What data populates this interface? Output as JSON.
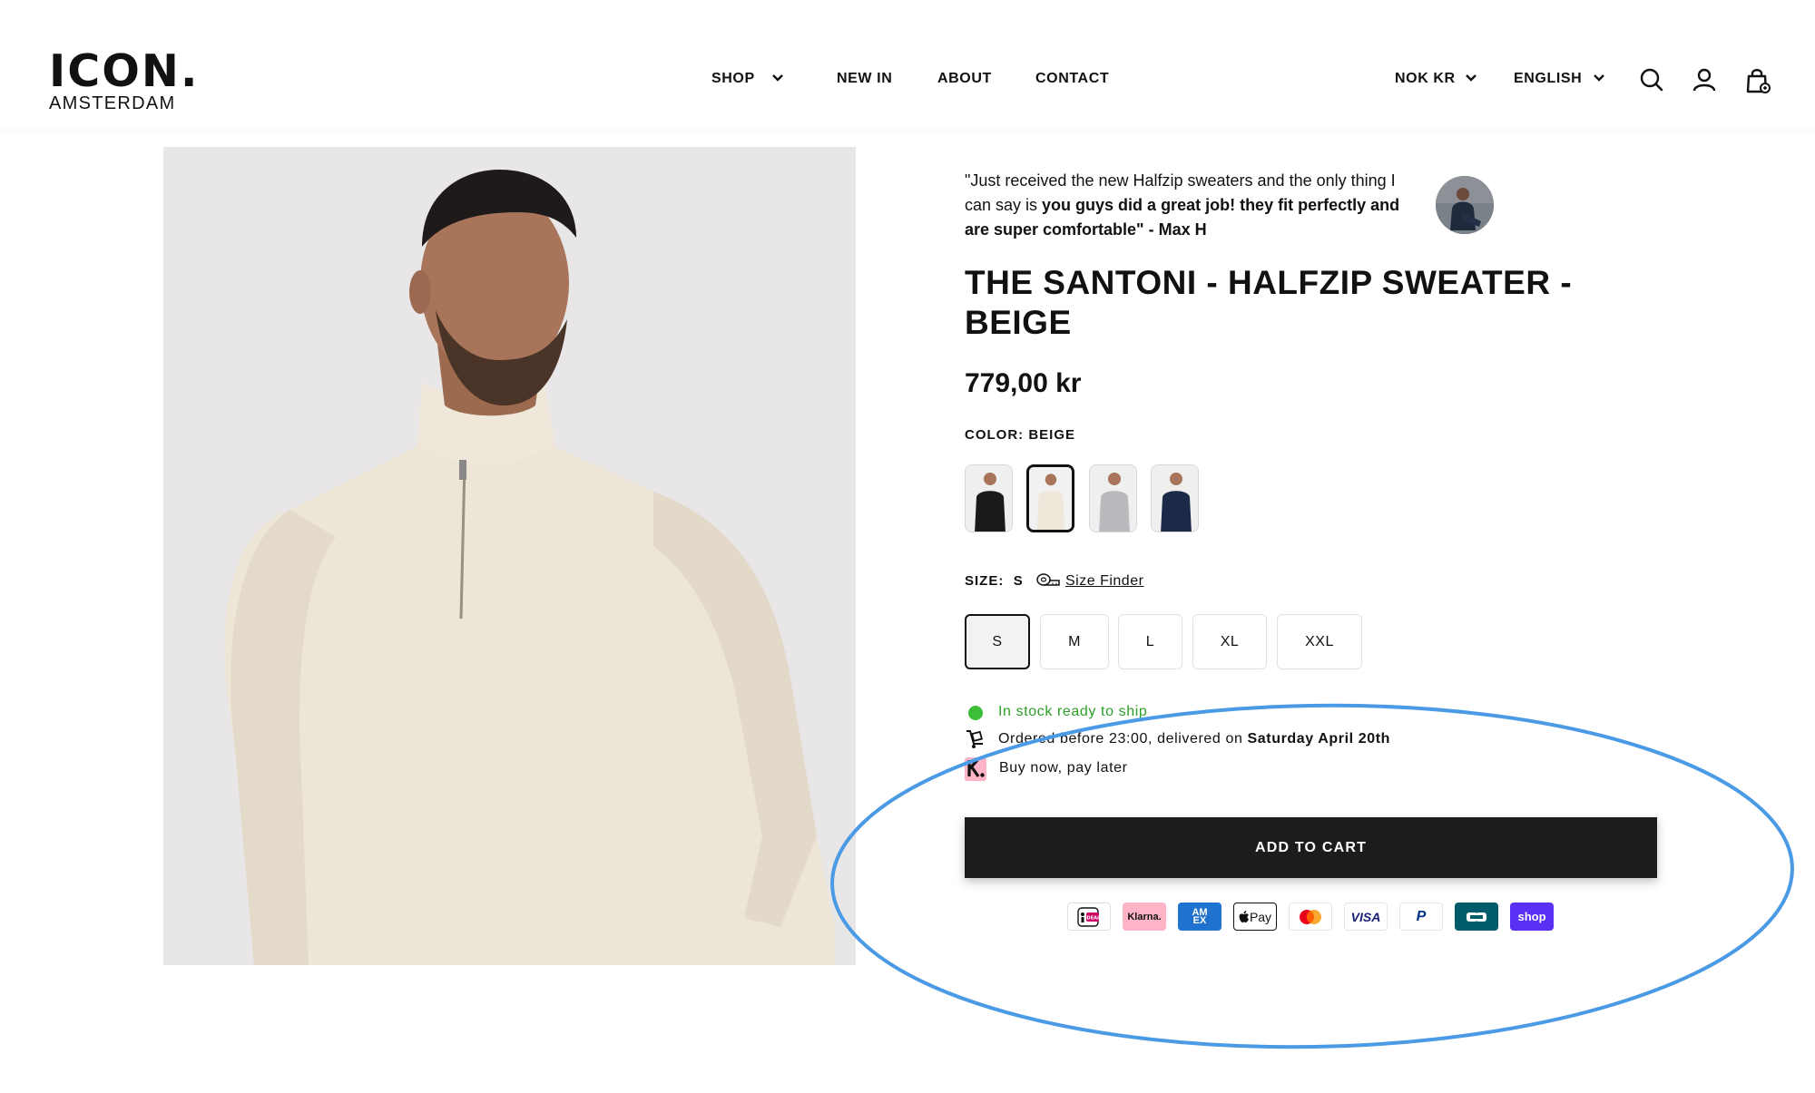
{
  "header": {
    "logo": {
      "main": "ICON.",
      "sub": "AMSTERDAM"
    },
    "nav": [
      {
        "label": "SHOP",
        "has_dropdown": true
      },
      {
        "label": "NEW IN",
        "has_dropdown": false
      },
      {
        "label": "ABOUT",
        "has_dropdown": false
      },
      {
        "label": "CONTACT",
        "has_dropdown": false
      }
    ],
    "currency": "NOK KR",
    "language": "ENGLISH",
    "icons": [
      "search-icon",
      "account-icon",
      "cart-icon"
    ]
  },
  "product": {
    "testimonial": {
      "text_plain": "\"Just received the new Halfzip sweaters and the only thing I can say is ",
      "text_bold": "you guys did a great job! they fit perfectly and are super comfortable\" - Max H"
    },
    "title": "THE SANTONI - HALFZIP SWEATER - BEIGE",
    "price": "779,00 kr",
    "color": {
      "label": "COLOR:",
      "value": "BEIGE",
      "swatches": [
        {
          "name": "black",
          "hex": "#1a1a1a",
          "selected": false
        },
        {
          "name": "beige",
          "hex": "#efe8da",
          "selected": true
        },
        {
          "name": "grey",
          "hex": "#b9babd",
          "selected": false
        },
        {
          "name": "navy",
          "hex": "#1b2a48",
          "selected": false
        }
      ]
    },
    "size": {
      "label": "SIZE:",
      "value": "S",
      "finder_label": "Size Finder",
      "options": [
        {
          "label": "S",
          "selected": true
        },
        {
          "label": "M",
          "selected": false
        },
        {
          "label": "L",
          "selected": false
        },
        {
          "label": "XL",
          "selected": false
        },
        {
          "label": "XXL",
          "selected": false
        }
      ]
    },
    "stock": "In stock ready to ship",
    "delivery": {
      "prefix": "Ordered before 23:00, delivered on ",
      "date": "Saturday April 20th"
    },
    "klarna": "Buy now, pay later",
    "add_to_cart": "ADD TO CART",
    "payment_methods": [
      {
        "name": "iDEAL",
        "label": "iDEAL"
      },
      {
        "name": "Klarna",
        "label": "Klarna."
      },
      {
        "name": "American Express",
        "label": "AM EX"
      },
      {
        "name": "Apple Pay",
        "label": "Pay"
      },
      {
        "name": "Mastercard",
        "label": ""
      },
      {
        "name": "Visa",
        "label": "VISA"
      },
      {
        "name": "PayPal",
        "label": "P"
      },
      {
        "name": "Bancontact",
        "label": ""
      },
      {
        "name": "Shop Pay",
        "label": "shop"
      }
    ]
  },
  "colors": {
    "accent_dark": "#1c1c1c",
    "stock_green": "#2e9e27",
    "annotation_blue": "#4a9ae6",
    "klarna_pink": "#ffb3c7",
    "shoppay_purple": "#5a31f4"
  }
}
